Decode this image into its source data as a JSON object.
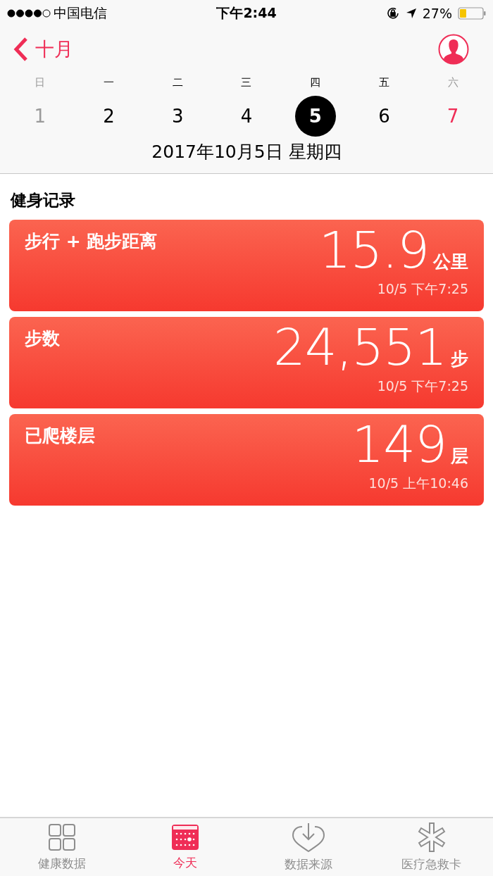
{
  "status_bar": {
    "carrier": "中国电信",
    "time": "下午2:44",
    "battery": "27%"
  },
  "nav": {
    "back": "十月"
  },
  "weekdays": [
    {
      "label": "日",
      "muted": true
    },
    {
      "label": "一",
      "muted": false
    },
    {
      "label": "二",
      "muted": false
    },
    {
      "label": "三",
      "muted": false
    },
    {
      "label": "四",
      "muted": false
    },
    {
      "label": "五",
      "muted": false
    },
    {
      "label": "六",
      "muted": true
    }
  ],
  "days": [
    {
      "label": "1",
      "kind": "muted",
      "selected": false
    },
    {
      "label": "2",
      "kind": "normal",
      "selected": false
    },
    {
      "label": "3",
      "kind": "normal",
      "selected": false
    },
    {
      "label": "4",
      "kind": "normal",
      "selected": false
    },
    {
      "label": "5",
      "kind": "normal",
      "selected": true
    },
    {
      "label": "6",
      "kind": "normal",
      "selected": false
    },
    {
      "label": "7",
      "kind": "accent",
      "selected": false
    }
  ],
  "date_title": "2017年10月5日 星期四",
  "section_title": "健身记录",
  "cards": [
    {
      "title": "步行 + 跑步距离",
      "value": "15.9",
      "unit": "公里",
      "time": "10/5 下午7:25"
    },
    {
      "title": "步数",
      "value": "24,551",
      "unit": "步",
      "time": "10/5 下午7:25"
    },
    {
      "title": "已爬楼层",
      "value": "149",
      "unit": "层",
      "time": "10/5 上午10:46"
    }
  ],
  "tabs": [
    {
      "label": "健康数据",
      "kind": "grid",
      "selected": false
    },
    {
      "label": "今天",
      "kind": "calendar",
      "selected": true
    },
    {
      "label": "数据来源",
      "kind": "heart",
      "selected": false
    },
    {
      "label": "医疗急救卡",
      "kind": "asterisk",
      "selected": false
    }
  ]
}
